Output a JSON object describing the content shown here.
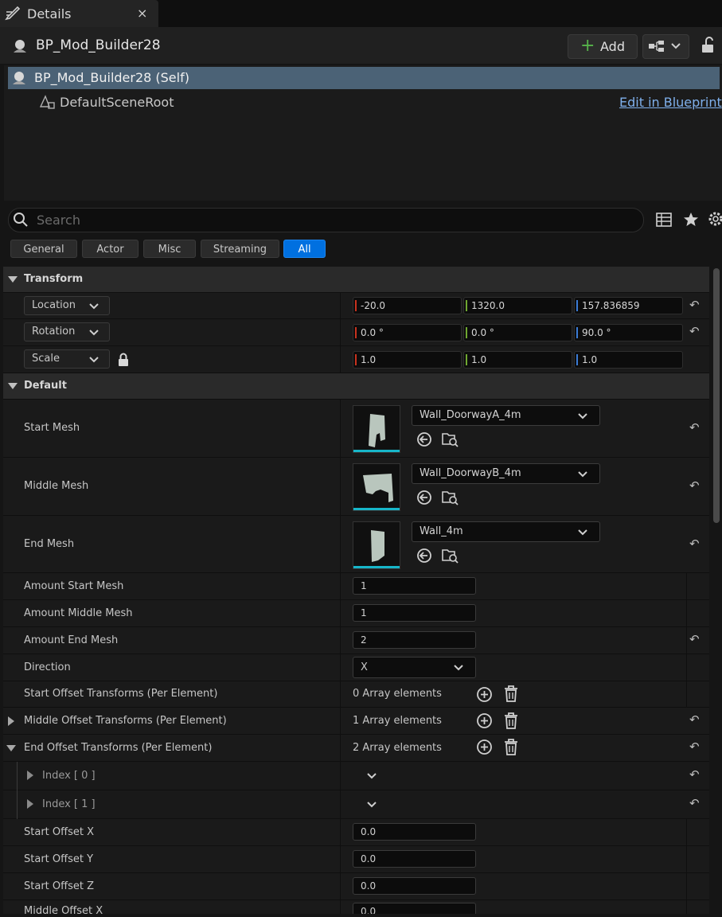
{
  "tab": {
    "title": "Details",
    "close": "×"
  },
  "header": {
    "actor_name": "BP_Mod_Builder28",
    "add_label": "Add"
  },
  "tree": {
    "self_label": "BP_Mod_Builder28 (Self)",
    "root_label": "DefaultSceneRoot",
    "edit_link": "Edit in Blueprint"
  },
  "search": {
    "placeholder": "Search"
  },
  "categories": [
    "General",
    "Actor",
    "Misc",
    "Streaming",
    "All"
  ],
  "transform": {
    "section_label": "Transform",
    "location": {
      "label": "Location",
      "x": "-20.0",
      "y": "1320.0",
      "z": "157.836859"
    },
    "rotation": {
      "label": "Rotation",
      "x": "0.0 °",
      "y": "0.0 °",
      "z": "90.0 °"
    },
    "scale": {
      "label": "Scale",
      "x": "1.0",
      "y": "1.0",
      "z": "1.0"
    }
  },
  "default": {
    "section_label": "Default",
    "start_mesh": {
      "label": "Start Mesh",
      "value": "Wall_DoorwayA_4m"
    },
    "middle_mesh": {
      "label": "Middle Mesh",
      "value": "Wall_DoorwayB_4m"
    },
    "end_mesh": {
      "label": "End Mesh",
      "value": "Wall_4m"
    },
    "amount_start": {
      "label": "Amount  Start Mesh",
      "value": "1"
    },
    "amount_middle": {
      "label": "Amount Middle Mesh",
      "value": "1"
    },
    "amount_end": {
      "label": "Amount  End Mesh",
      "value": "2"
    },
    "direction": {
      "label": "Direction",
      "value": "X"
    },
    "start_offsets": {
      "label": "Start Offset Transforms (Per Element)",
      "count": "0 Array elements"
    },
    "middle_offsets": {
      "label": "Middle Offset Transforms (Per Element)",
      "count": "1 Array elements"
    },
    "end_offsets": {
      "label": "End Offset Transforms (Per Element)",
      "count": "2 Array elements"
    },
    "index0": {
      "label": "Index [ 0 ]"
    },
    "index1": {
      "label": "Index [ 1 ]"
    },
    "start_offset_x": {
      "label": "Start Offset X",
      "value": "0.0"
    },
    "start_offset_y": {
      "label": "Start Offset Y",
      "value": "0.0"
    },
    "start_offset_z": {
      "label": "Start Offset Z",
      "value": "0.0"
    },
    "middle_offset_x": {
      "label": "Middle Offset X",
      "value": "0.0"
    }
  },
  "colors": {
    "selection": "#4b6276",
    "accent_blue": "#0070e0",
    "thumb_bar": "#17b6c9",
    "link": "#7fb0ec"
  },
  "icons": [
    "edit-icon",
    "close-icon",
    "actor-icon",
    "plus-icon",
    "hierarchy-icon",
    "chevron-down-icon",
    "unlock-icon",
    "scene-root-icon",
    "search-icon",
    "table-icon",
    "star-icon",
    "gear-icon",
    "reset-icon",
    "lock-icon",
    "browse-icon",
    "find-in-browser-icon",
    "add-element-icon",
    "trash-icon",
    "expand-arrow-icon"
  ]
}
